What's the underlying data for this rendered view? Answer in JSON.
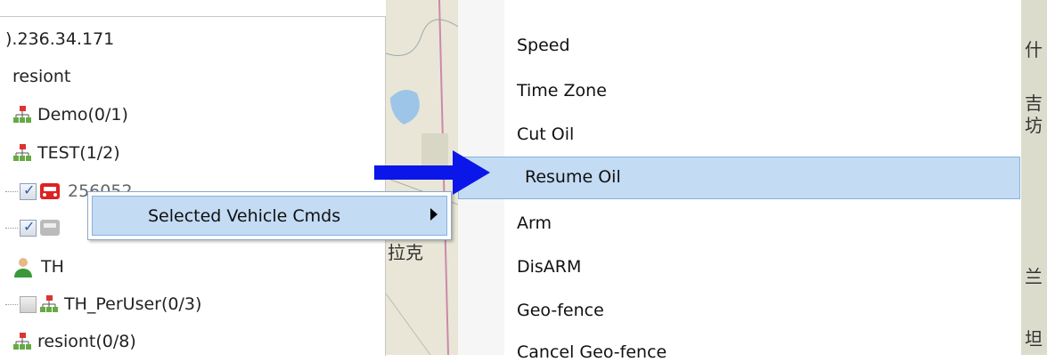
{
  "tree": {
    "ip": ").236.34.171",
    "user": "resiont",
    "nodes": [
      {
        "label": "Demo(0/1)"
      },
      {
        "label": "TEST(1/2)"
      },
      {
        "label": "256052"
      },
      {
        "label": ""
      },
      {
        "label": "TH"
      },
      {
        "label": "TH_PerUser(0/3)"
      },
      {
        "label": "resiont(0/8)"
      }
    ]
  },
  "context_menu": {
    "item": "Selected Vehicle Cmds"
  },
  "submenu": {
    "items": [
      "Speed",
      "Time Zone",
      "Cut Oil",
      "Resume Oil",
      "Arm",
      "DisARM",
      "Geo-fence",
      "Cancel Geo-fence"
    ],
    "selected_index": 3
  },
  "map": {
    "left_label": "拉克",
    "right_labels": [
      "什",
      "吉",
      "坊",
      "兰",
      "坦"
    ]
  },
  "colors": {
    "highlight": "#c3dbf3",
    "highlight_border": "#86b2e0",
    "arrow": "#0a17e8"
  }
}
